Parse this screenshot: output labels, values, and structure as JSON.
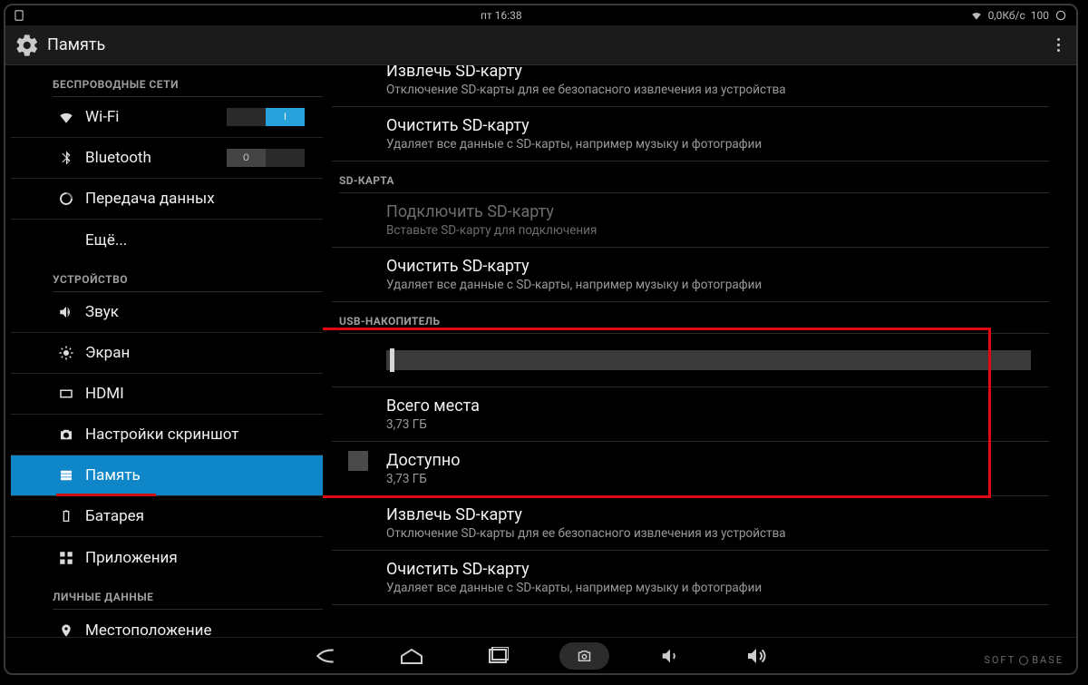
{
  "statusbar": {
    "time": "пт 16:38",
    "net": "0,0Кб/с",
    "battery": "100"
  },
  "header": {
    "title": "Память"
  },
  "sidebar": {
    "section_wireless": "БЕСПРОВОДНЫЕ СЕТИ",
    "wifi": "Wi-Fi",
    "wifi_toggle": "I",
    "bluetooth": "Bluetooth",
    "bt_toggle": "O",
    "data": "Передача данных",
    "more": "Ещё...",
    "section_device": "УСТРОЙСТВО",
    "sound": "Звук",
    "display": "Экран",
    "hdmi": "HDMI",
    "screenshot": "Настройки скриншот",
    "storage": "Память",
    "battery": "Батарея",
    "apps": "Приложения",
    "section_personal": "ЛИЧНЫЕ ДАННЫЕ",
    "location": "Местоположение"
  },
  "main": {
    "eject_sd_title": "Извлечь SD-карту",
    "eject_sd_sub": "Отключение SD-карты для ее безопасного извлечения из устройства",
    "erase_sd_title": "Очистить SD-карту",
    "erase_sd_sub": "Удаляет все данные с SD-карты, например музыку и фотографии",
    "cat_sdcard": "SD-КАРТА",
    "mount_sd_title": "Подключить SD-карту",
    "mount_sd_sub": "Вставьте SD-карту для подключения",
    "erase_sd2_title": "Очистить SD-карту",
    "erase_sd2_sub": "Удаляет все данные с SD-карты, например музыку и фотографии",
    "cat_usb": "USB-НАКОПИТЕЛЬ",
    "total_title": "Всего места",
    "total_value": "3,73 ГБ",
    "avail_title": "Доступно",
    "avail_value": "3,73 ГБ",
    "eject_usb_title": "Извлечь SD-карту",
    "eject_usb_sub": "Отключение SD-карты для ее безопасного извлечения из устройства",
    "erase_usb_title": "Очистить SD-карту",
    "erase_usb_sub": "Удаляет все данные с SD-карты, например музыку и фотографии"
  },
  "watermark": {
    "a": "SOFT",
    "b": "BASE"
  }
}
